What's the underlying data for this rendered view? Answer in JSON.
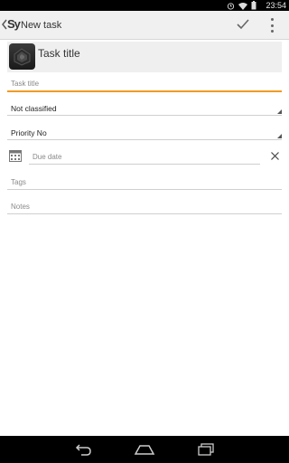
{
  "status_bar": {
    "time": "23:54",
    "icons": [
      "alarm-icon",
      "wifi-icon",
      "battery-icon"
    ]
  },
  "action_bar": {
    "app_logo": "Sy",
    "title": "New task"
  },
  "header": {
    "title": "Task title"
  },
  "form": {
    "task_title_placeholder": "Task title",
    "classification_value": "Not classified",
    "priority_value": "Priority No",
    "due_date_placeholder": "Due date",
    "tags_placeholder": "Tags",
    "notes_placeholder": "Notes"
  },
  "colors": {
    "accent": "#f19a22",
    "actionbar": "#f0f0f0"
  },
  "nav_bar": {
    "buttons": [
      "back-nav-icon",
      "home-nav-icon",
      "recents-nav-icon"
    ]
  }
}
